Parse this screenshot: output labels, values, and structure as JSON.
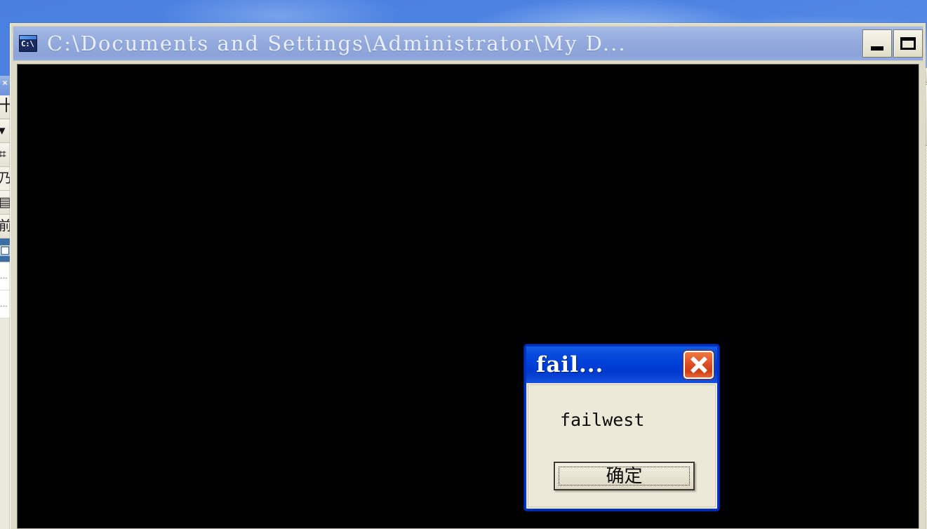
{
  "desktop": {
    "wallpaper_name": "blue-sky-wallpaper",
    "sky_top_color": "#4a7fe0",
    "sky_bottom_color": "#9dc0f3"
  },
  "background_window": {
    "name": "partially-occluded-window",
    "close_glyph": "×",
    "rows": [
      {
        "glyph": "十",
        "label": ""
      },
      {
        "glyph": "▾",
        "label": ""
      },
      {
        "glyph": "⌗",
        "label": ""
      },
      {
        "glyph": "乃",
        "label": ""
      },
      {
        "glyph": "▤",
        "label": ""
      },
      {
        "glyph": "前",
        "label": ""
      },
      {
        "glyph": "▣",
        "label": ""
      }
    ],
    "empty_rows": [
      "...",
      "..."
    ]
  },
  "console_window": {
    "icon": "command-prompt-icon",
    "icon_text": "C:\\",
    "title": "C:\\Documents and Settings\\Administrator\\My D...",
    "titlebar_color": "#92a8dc",
    "client_background": "#000000",
    "controls": [
      {
        "name": "minimize-button",
        "glyph": "minimize-icon"
      },
      {
        "name": "maximize-button",
        "glyph": "maximize-icon"
      }
    ]
  },
  "dialog": {
    "title": "fail...",
    "message": "failwest",
    "ok_label": "确定",
    "close_label": "close-icon",
    "titlebar_color": "#0040d8",
    "border_color": "#0032c8",
    "face_color": "#ece9d8",
    "close_button_color": "#e4552a"
  },
  "right_scrollbar": {
    "name": "vertical-scrollbar-sliver",
    "up_arrow": "scroll-up-icon",
    "down_arrow": "scroll-down-icon"
  }
}
